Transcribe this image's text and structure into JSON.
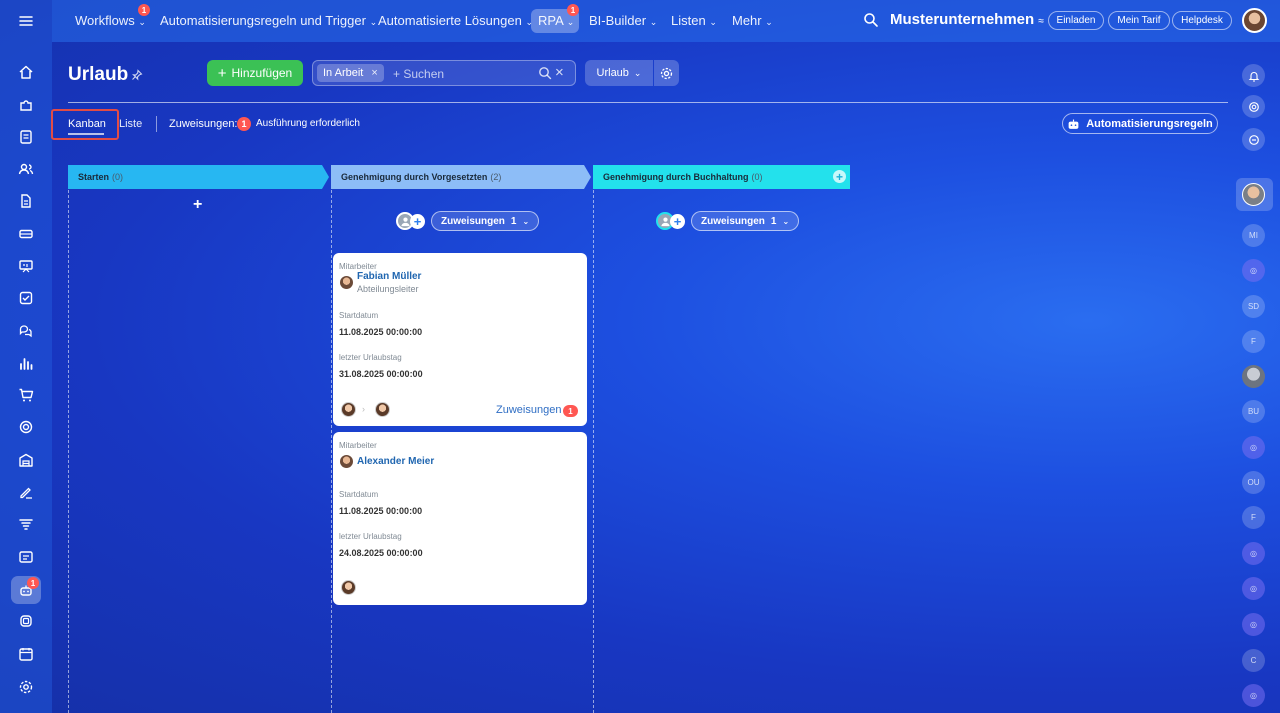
{
  "topbar": {
    "menu_icon": "hamburger-icon",
    "items": [
      {
        "label": "Workflows",
        "badge": "1"
      },
      {
        "label": "Automatisierungsregeln und Trigger"
      },
      {
        "label": "Automatisierte Lösungen"
      },
      {
        "label": "RPA",
        "badge": "1"
      },
      {
        "label": "BI-Builder"
      },
      {
        "label": "Listen"
      },
      {
        "label": "Mehr"
      }
    ],
    "company": "Musterunternehmen",
    "invite": "Einladen",
    "plan": "Mein Tarif",
    "help": "Helpdesk"
  },
  "page": {
    "title": "Urlaub",
    "add_label": "Hinzufügen",
    "filter_tag": "In Arbeit",
    "search_placeholder": "+ Suchen",
    "view_select": "Urlaub"
  },
  "views": {
    "kanban": "Kanban",
    "liste": "Liste",
    "assign_label": "Zuweisungen:",
    "assign_count": "1",
    "assign_text": "Ausführung erforderlich",
    "automation": "Automatisierungsregeln"
  },
  "stages": [
    {
      "name": "Starten",
      "count": "(0)",
      "color": "#27b7f2"
    },
    {
      "name": "Genehmigung durch Vorgesetzten",
      "count": "(2)",
      "color": "#8dbdf7"
    },
    {
      "name": "Genehmigung durch Buchhaltung",
      "count": "(0)",
      "color": "#23e1ec"
    }
  ],
  "column_assign": {
    "label": "Zuweisungen",
    "count": "1"
  },
  "cards": [
    {
      "employee_label": "Mitarbeiter",
      "employee": "Fabian Müller",
      "role": "Abteilungsleiter",
      "start_label": "Startdatum",
      "start": "11.08.2025 00:00:00",
      "end_label": "letzter Urlaubstag",
      "end": "31.08.2025 00:00:00",
      "assign_link": "Zuweisungen",
      "assign_badge": "1"
    },
    {
      "employee_label": "Mitarbeiter",
      "employee": "Alexander Meier",
      "start_label": "Startdatum",
      "start": "11.08.2025 00:00:00",
      "end_label": "letzter Urlaubstag",
      "end": "24.08.2025 00:00:00"
    }
  ],
  "left_rail": {
    "active_badge": "1",
    "icons": [
      "home-icon",
      "puzzle-icon",
      "feed-icon",
      "contacts-icon",
      "document-icon",
      "card-icon",
      "presentation-icon",
      "tasks-icon",
      "chat-icon",
      "analytics-icon",
      "cart-icon",
      "target-icon",
      "warehouse-icon",
      "signature-icon",
      "filter-icon",
      "sites-icon",
      "robot-icon",
      "stack-icon",
      "calendar-icon",
      "settings-icon"
    ]
  },
  "right_rail": {
    "initials": [
      "MI",
      "SD",
      "F",
      "BU",
      "OU",
      "F",
      "C"
    ]
  }
}
